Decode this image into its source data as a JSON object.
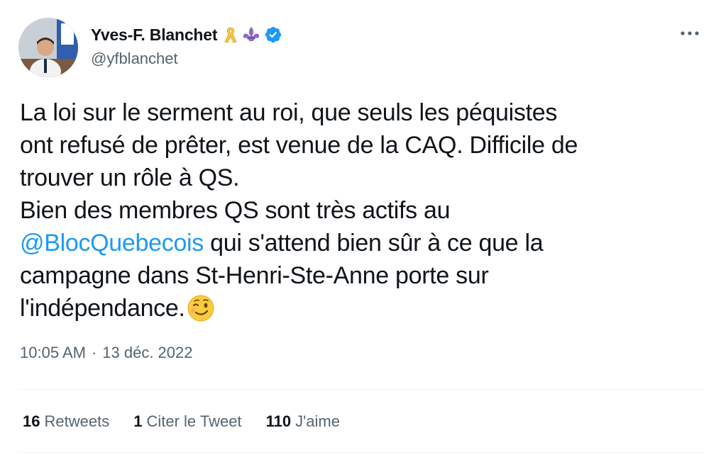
{
  "author": {
    "display_name": "Yves-F. Blanchet",
    "handle": "@yfblanchet",
    "badges": [
      "yellow-ribbon-icon",
      "fleur-de-lis-icon",
      "verified-badge-icon"
    ]
  },
  "tweet": {
    "lines": [
      "La loi sur le serment au roi, que seuls les péquistes",
      "ont refusé de prêter, est venue de la CAQ. Difficile de",
      "trouver un rôle à QS.",
      "Bien des membres QS sont très actifs au"
    ],
    "mention": "@BlocQuebecois",
    "after_mention": " qui s'attend bien sûr à ce que la",
    "line6": "campagne dans St-Henri-Ste-Anne porte sur",
    "line7": "l'indépendance.",
    "emoji": "winking-face-icon"
  },
  "meta": {
    "time": "10:05 AM",
    "separator": "·",
    "date": "13 déc. 2022"
  },
  "stats": {
    "retweets_count": "16",
    "retweets_label": "Retweets",
    "quotes_count": "1",
    "quotes_label": "Citer le Tweet",
    "likes_count": "110",
    "likes_label": "J'aime"
  },
  "colors": {
    "text": "#0f1419",
    "secondary": "#536471",
    "link": "#1d9bf0",
    "divider": "#eff3f4",
    "verified": "#1d9bf0",
    "ribbon": "#f5c542",
    "fleur": "#8e6cc4"
  }
}
